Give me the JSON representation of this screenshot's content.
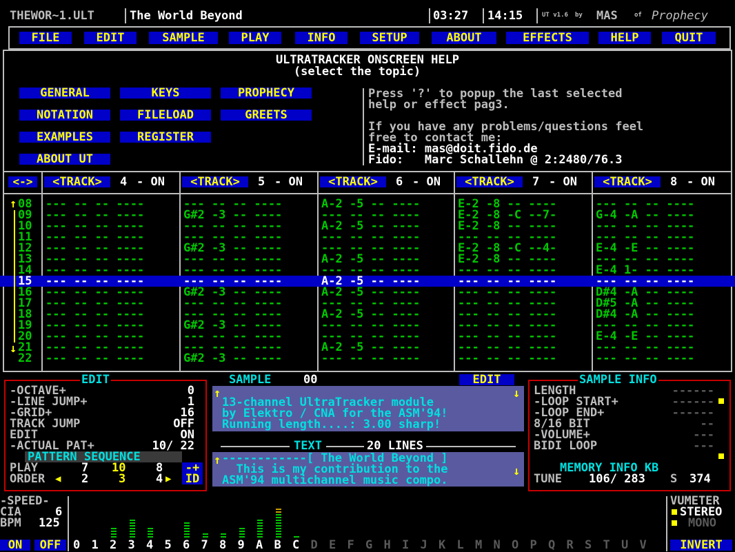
{
  "titlebar": {
    "filename": "THEWOR~1.ULT",
    "song_title": "The World Beyond",
    "time_elapsed": "03:27",
    "clock": "14:15",
    "version": "UT v1.6",
    "by": "by",
    "author": "MAS",
    "of": "of",
    "group": "Prophecy"
  },
  "menu": [
    "FILE",
    "EDIT",
    "SAMPLE",
    "PLAY",
    "INFO",
    "SETUP",
    "ABOUT",
    "EFFECTS",
    "HELP",
    "QUIT"
  ],
  "help": {
    "title": "ULTRATRACKER ONSCREEN HELP",
    "subtitle": "(select the topic)",
    "topics": [
      "GENERAL",
      "KEYS",
      "PROPHECY",
      "NOTATION",
      "FILELOAD",
      "GREETS",
      "EXAMPLES",
      "REGISTER",
      "ABOUT UT"
    ],
    "text_lines": [
      "Press '?' to popup the last selected",
      "help or effect pag3.",
      "",
      "If you have any problems/questions feel",
      "free to contact me:",
      "E-mail: mas@doit.fido.de",
      "Fido:   Marc Schallehn @ 2:2480/76.3"
    ]
  },
  "pattern": {
    "scroll_button": "<->",
    "tracks": [
      {
        "label": "<TRACK>",
        "num": "4",
        "state": "- ON"
      },
      {
        "label": "<TRACK>",
        "num": "5",
        "state": "- ON"
      },
      {
        "label": "<TRACK>",
        "num": "6",
        "state": "- ON"
      },
      {
        "label": "<TRACK>",
        "num": "7",
        "state": "- ON"
      },
      {
        "label": "<TRACK>",
        "num": "8",
        "state": "- ON"
      }
    ],
    "rows": [
      {
        "n": "08",
        "c": [
          "--- -- -- ----",
          "--- -- -- ----",
          "A-2 -5 -- ----",
          "E-2 -8 -- ----",
          "--- -- -- ----"
        ]
      },
      {
        "n": "09",
        "c": [
          "--- -- -- ----",
          "G#2 -3 -- ----",
          "--- -- -- ----",
          "E-2 -8 -C --7-",
          "G-4 -A -- ----"
        ]
      },
      {
        "n": "10",
        "c": [
          "--- -- -- ----",
          "--- -- -- ----",
          "A-2 -5 -- ----",
          "E-2 -8 -- ----",
          "--- -- -- ----"
        ]
      },
      {
        "n": "11",
        "c": [
          "--- -- -- ----",
          "--- -- -- ----",
          "--- -- -- ----",
          "--- -- -- ----",
          "--- -- -- ----"
        ]
      },
      {
        "n": "12",
        "c": [
          "--- -- -- ----",
          "G#2 -3 -- ----",
          "--- -- -- ----",
          "E-2 -8 -C --4-",
          "E-4 -E -- ----"
        ]
      },
      {
        "n": "13",
        "c": [
          "--- -- -- ----",
          "--- -- -- ----",
          "A-2 -5 -- ----",
          "E-2 -8 -- ----",
          "--- -- -- ----"
        ]
      },
      {
        "n": "14",
        "c": [
          "--- -- -- ----",
          "--- -- -- ----",
          "--- -- -- ----",
          "--- -- -- ----",
          "E-4 1- -- ----"
        ]
      },
      {
        "n": "15",
        "c": [
          "--- -- -- ----",
          "--- -- -- ----",
          "A-2 -5 -- ----",
          "--- -- -- ----",
          "--- -- -- ----"
        ]
      },
      {
        "n": "16",
        "c": [
          "--- -- -- ----",
          "G#2 -3 -- ----",
          "A-2 -5 -- ----",
          "--- -- -- ----",
          "D#4 -A -- ----"
        ]
      },
      {
        "n": "17",
        "c": [
          "--- -- -- ----",
          "--- -- -- ----",
          "--- -- -- ----",
          "--- -- -- ----",
          "D#5 -A -- ----"
        ]
      },
      {
        "n": "18",
        "c": [
          "--- -- -- ----",
          "--- -- -- ----",
          "A-2 -5 -- ----",
          "--- -- -- ----",
          "D#4 -A -- ----"
        ]
      },
      {
        "n": "19",
        "c": [
          "--- -- -- ----",
          "G#2 -3 -- ----",
          "--- -- -- ----",
          "--- -- -- ----",
          "--- -- -- ----"
        ]
      },
      {
        "n": "20",
        "c": [
          "--- -- -- ----",
          "--- -- -- ----",
          "--- -- -- ----",
          "--- -- -- ----",
          "E-4 -E -- ----"
        ]
      },
      {
        "n": "21",
        "c": [
          "--- -- -- ----",
          "--- -- -- ----",
          "A-2 -5 -- ----",
          "--- -- -- ----",
          "--- -- -- ----"
        ]
      },
      {
        "n": "22",
        "c": [
          "--- -- -- ----",
          "G#2 -3 -- ----",
          "--- -- -- ----",
          "--- -- -- ----",
          "--- -- -- ----"
        ]
      }
    ],
    "current_row": "15"
  },
  "edit": {
    "title": "EDIT",
    "rows": [
      {
        "label": "-OCTAVE+",
        "value": "0"
      },
      {
        "label": "-LINE JUMP+",
        "value": "1"
      },
      {
        "label": "-GRID+",
        "value": "16"
      },
      {
        "label": "TRACK JUMP",
        "value": "OFF"
      },
      {
        "label": "EDIT",
        "value": "ON"
      },
      {
        "label": "-ACTUAL PAT+",
        "value": "10/ 22"
      }
    ],
    "seq_title": "PATTERN SEQUENCE",
    "play_label": "PLAY",
    "play_vals": [
      "7",
      "10",
      "8"
    ],
    "play_btn": "-+",
    "order_label": "ORDER",
    "order_vals": [
      "2",
      "3",
      "4"
    ],
    "order_btn": "ID"
  },
  "sample": {
    "title": "SAMPLE",
    "number": "00",
    "edit_btn": "EDIT",
    "lines": [
      "13-channel UltraTracker module",
      "by Elektro / CNA for the ASM'94!",
      "Running length....: 3.00 sharp!"
    ],
    "text_title": "TEXT",
    "text_lines_count": "20 LINES",
    "text_content": [
      "------------[ The World Beyond ]",
      "  This is my contribution to the",
      "ASM'94 multichannel music compo."
    ]
  },
  "sample_info": {
    "title": "SAMPLE INFO",
    "rows": [
      {
        "label": "LENGTH",
        "value": "------"
      },
      {
        "label": "-LOOP START+",
        "value": "------"
      },
      {
        "label": "-LOOP END+",
        "value": "------"
      },
      {
        "label": "8/16 BIT",
        "value": "--"
      },
      {
        "label": "-VOLUME+",
        "value": "---"
      },
      {
        "label": "BIDI LOOP",
        "value": "---"
      }
    ],
    "mem_title": "MEMORY INFO KB",
    "tune_label": "TUNE",
    "tune_value": "106/ 283",
    "s_label": "S",
    "s_value": "374"
  },
  "speed": {
    "title": "-SPEED-",
    "cia_label": "CIA",
    "cia_value": "6",
    "bpm_label": "BPM",
    "bpm_value": "125",
    "on_btn": "ON",
    "off_btn": "OFF"
  },
  "channels": {
    "labels": [
      "0",
      "1",
      "2",
      "3",
      "4",
      "5",
      "6",
      "7",
      "8",
      "9",
      "A",
      "B",
      "C",
      "D",
      "E",
      "F",
      "G",
      "H",
      "I",
      "J",
      "K",
      "L",
      "M",
      "N",
      "O",
      "P",
      "Q",
      "R",
      "S",
      "T",
      "U",
      "V"
    ],
    "active_count": 13,
    "levels": [
      0,
      0,
      0.3,
      0.6,
      0.35,
      0,
      0.5,
      0.2,
      0.15,
      0.3,
      0.6,
      0.95,
      0.1,
      0,
      0,
      0,
      0,
      0,
      0,
      0,
      0,
      0,
      0,
      0,
      0,
      0,
      0,
      0,
      0,
      0,
      0,
      0
    ]
  },
  "vumeter": {
    "title": "VUMETER",
    "stereo": "STEREO",
    "mono": "MONO",
    "invert": "INVERT"
  }
}
